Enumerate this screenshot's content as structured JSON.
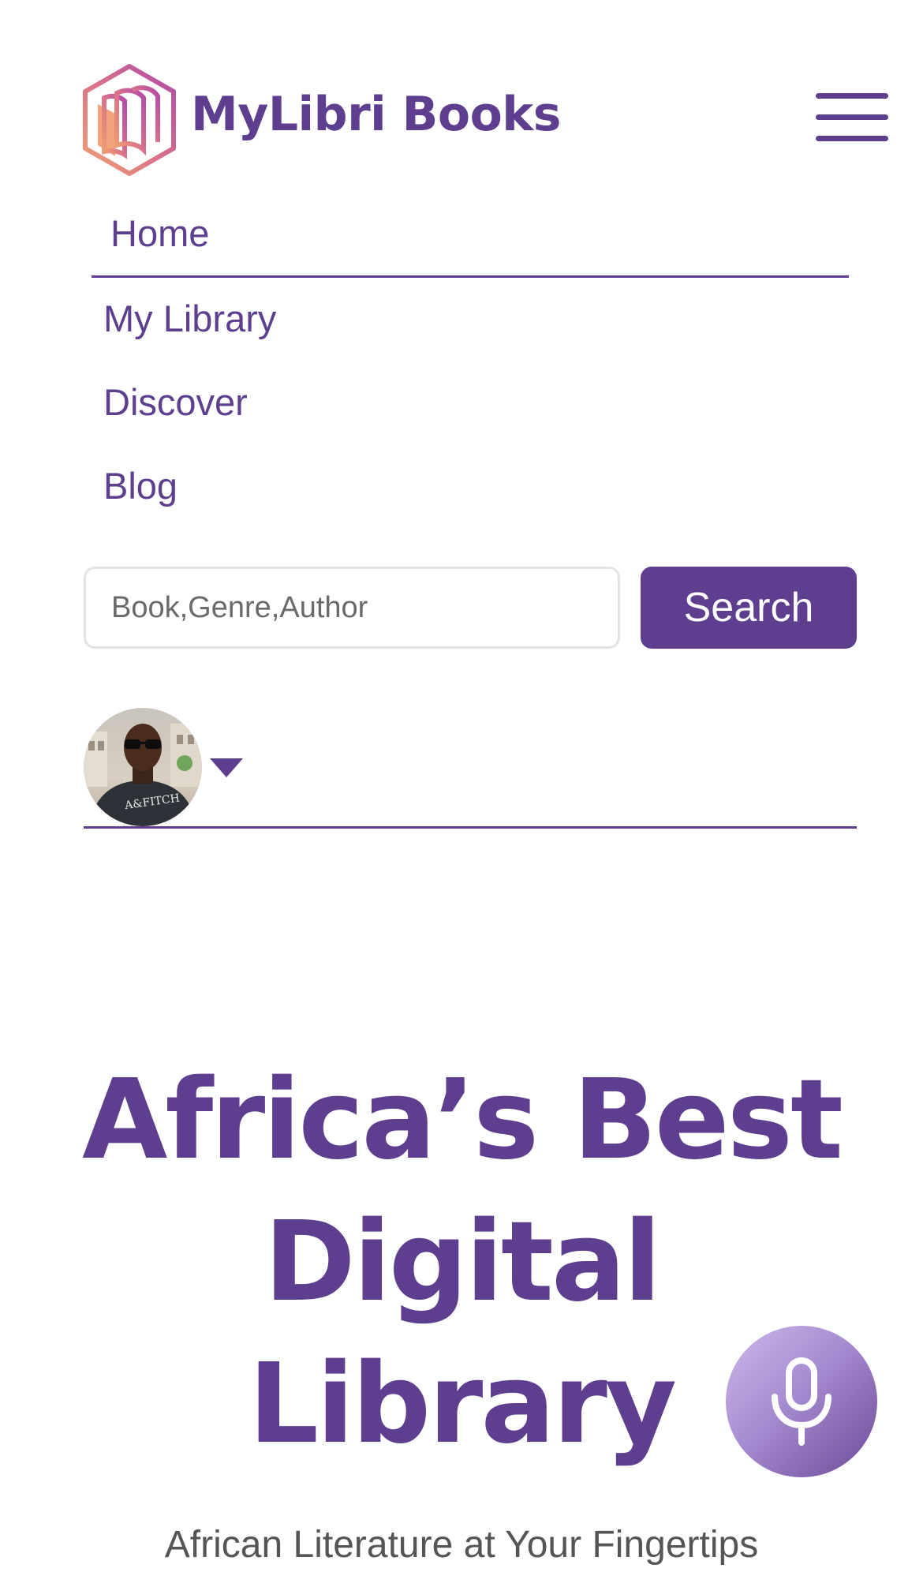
{
  "header": {
    "brand_name": "MyLibri Books",
    "logo_icon": "hexagon-books-logo",
    "menu_icon": "hamburger-menu-icon"
  },
  "nav": {
    "items": [
      {
        "label": "Home",
        "active": true
      },
      {
        "label": "My Library"
      },
      {
        "label": "Discover"
      },
      {
        "label": "Blog"
      }
    ]
  },
  "search": {
    "placeholder": "Book,Genre,Author",
    "value": "",
    "button_label": "Search"
  },
  "user": {
    "avatar_icon": "user-avatar",
    "dropdown_icon": "caret-down-icon"
  },
  "hero": {
    "title": "Africa’s Best Digital Library",
    "subtitle": "African Literature at Your Fingertips"
  },
  "voice": {
    "icon": "microphone-icon"
  },
  "colors": {
    "brand_purple": "#5e3f8f",
    "logo_gradient_start": "#e8906a",
    "logo_gradient_end": "#b84aa8",
    "input_border": "#e3e3e3",
    "subtitle_gray": "#555555"
  }
}
